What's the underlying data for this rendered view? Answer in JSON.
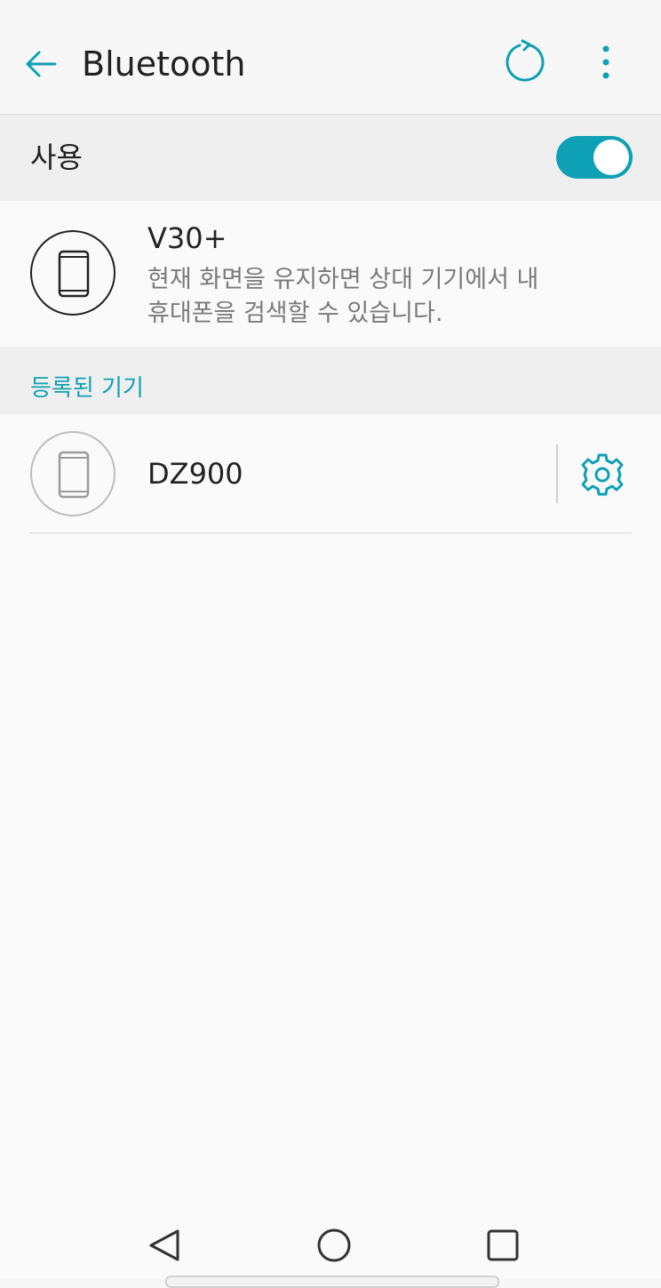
{
  "appbar": {
    "title": "Bluetooth"
  },
  "toggle": {
    "label": "사용",
    "state": "on",
    "color": "#0ea0b4"
  },
  "my_device": {
    "name": "V30+",
    "description": "현재 화면을 유지하면 상대 기기에서 내\n휴대폰을 검색할 수 있습니다."
  },
  "paired_section": {
    "label": "등록된 기기",
    "devices": [
      {
        "name": "DZ900",
        "icon": "phone-icon"
      }
    ]
  },
  "icons": {
    "back": "back-arrow-icon",
    "refresh": "refresh-icon",
    "menu": "more-vert-icon",
    "settings": "gear-icon"
  },
  "accent_color": "#0ea0b4"
}
